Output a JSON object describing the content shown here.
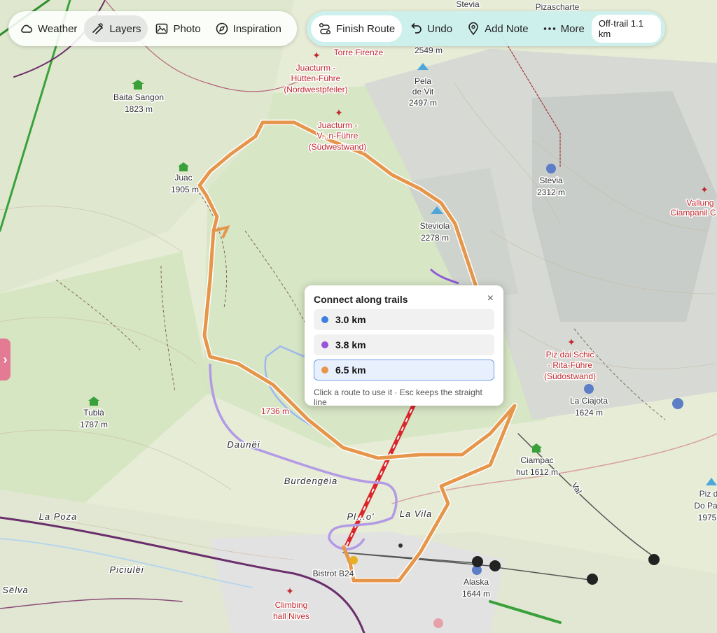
{
  "toolbar_left": [
    {
      "label": "Weather",
      "icon": "cloud-icon",
      "active": false
    },
    {
      "label": "Layers",
      "icon": "layers-icon",
      "active": true
    },
    {
      "label": "Photo",
      "icon": "photo-icon",
      "active": false
    },
    {
      "label": "Inspiration",
      "icon": "compass-icon",
      "active": false
    }
  ],
  "toolbar_right": {
    "finish_route": "Finish Route",
    "undo": "Undo",
    "add_note": "Add Note",
    "more": "More",
    "off_trail": "Off-trail 1.1 km"
  },
  "sidetab": "›",
  "popup": {
    "title": "Connect along trails",
    "close": "×",
    "options": [
      {
        "label": "3.0 km",
        "color": "#3f7fe0",
        "selected": false
      },
      {
        "label": "3.8 km",
        "color": "#9856d6",
        "selected": false
      },
      {
        "label": "6.5 km",
        "color": "#e5964b",
        "selected": true
      }
    ],
    "hint": "Click a route to use it · Esc keeps the straight line"
  },
  "map_labels": {
    "stevia_top": "Stevia",
    "pizascharte": "Pizascharte",
    "torre_firenze": "Torre Firenze",
    "elev_2549": "2549 m",
    "juacturm1": "Juacturm -",
    "hutten": "Hütten-Führe",
    "nordwest": "(Nordwestpfeiler)",
    "pela": "Pela",
    "devit": "de Vit",
    "elev_2497": "2497 m",
    "baita": "Baita Sangon",
    "elev_1823": "1823 m",
    "juacturm2": "Juacturm -",
    "vnn": "V...n-Führe",
    "sudwestwand": "(Südwestwand)",
    "juac": "Juac",
    "elev_1905": "1905 m",
    "stevia_hut": "Stevia",
    "elev_2312": "2312 m",
    "steviola": "Steviola",
    "elev_2278": "2278 m",
    "vallunga": "Vallung",
    "ciampanil": "Ciampanil C",
    "piz_schic": "Piz dai Schic",
    "rita": "- Rita-Führe",
    "sudostwand": "(Südostwand)",
    "la_ciajota": "La Ciajota",
    "elev_1624": "1624 m",
    "tubla": "Tublà",
    "elev_1787": "1787 m",
    "elev_1736": "1736 m",
    "daunei": "Daunëi",
    "ciampac": "Ciampac",
    "hut1612": "hut 1612 m",
    "burdengeia": "Burdengëia",
    "la_poza": "La Poza",
    "plan": "Pl...o'",
    "la_vila": "La Vila",
    "piz_do": "Piz d",
    "do_pa": "Do Pa",
    "elev_1975": "1975",
    "piciulei": "Piciulëi",
    "bistrot": "Bistrot B24",
    "alaska": "Alaska",
    "elev_1644": "1644 m",
    "selva": "Sëlva",
    "climbing": "Climbing",
    "hall_nives": "hall Nives",
    "val": "Val"
  },
  "colors": {
    "route_orange": "#e5964b",
    "route_purple": "#b39ae6",
    "route_blue": "#9fb8f0",
    "toolbar_accent": "#cff0ee",
    "sidetab": "#e27b93"
  }
}
